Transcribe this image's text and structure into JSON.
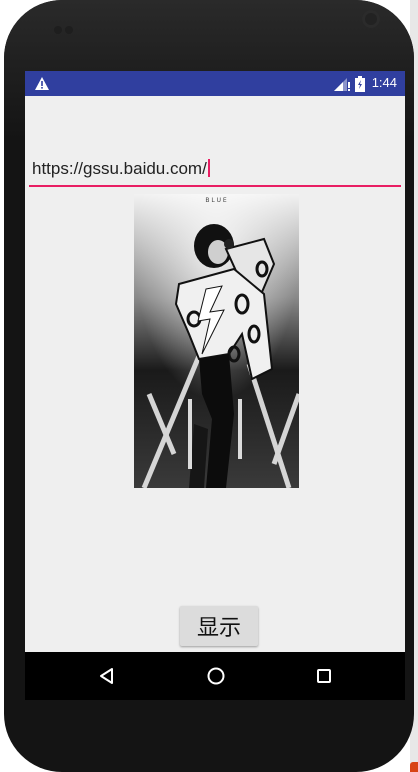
{
  "status_bar": {
    "time": "1:44",
    "warning_icon": "warning-icon",
    "signal_icon": "signal-icon",
    "battery_icon": "battery-icon",
    "color": "#303f9f"
  },
  "url_input": {
    "value": "https://gssu.baidu.com/",
    "accent_color": "#e91e63"
  },
  "image": {
    "semantic": "black-and-white concert photo of a performer holding a microphone",
    "top_text": "B L U E"
  },
  "show_button": {
    "label": "显示"
  },
  "nav_bar": {
    "back_icon": "back-triangle-icon",
    "home_icon": "home-circle-icon",
    "recents_icon": "recents-square-icon"
  }
}
